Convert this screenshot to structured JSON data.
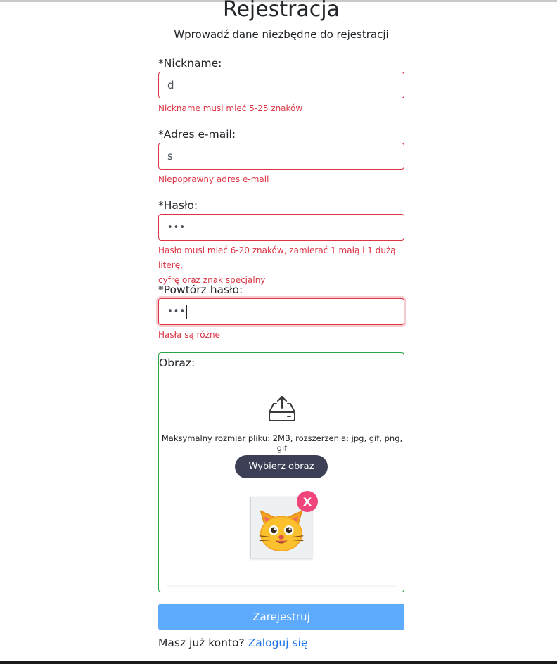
{
  "page": {
    "title": "Rejestracja",
    "subtitle": "Wprowadź dane niezbędne do rejestracji"
  },
  "form": {
    "nickname": {
      "label": "*Nickname:",
      "value": "d",
      "error": "Nickname musi mieć 5-25 znaków"
    },
    "email": {
      "label": "*Adres e-mail:",
      "value": "s",
      "error": "Niepoprawny adres e-mail"
    },
    "password": {
      "label": "*Hasło:",
      "value": "•••",
      "error_line1": "Hasło musi mieć 6-20 znaków, zamierać 1 małą i 1 dużą literę,",
      "error_line2": "cyfrę oraz znak specjalny"
    },
    "password_repeat": {
      "label": "*Powtórz hasło:",
      "value": "•••",
      "error": "Hasła są różne"
    },
    "image": {
      "label": "Obraz:",
      "info": "Maksymalny rozmiar pliku: 2MB, rozszerzenia: jpg, gif, png, gif",
      "button": "Wybierz obraz",
      "remove": "X",
      "icon": "upload-tray-icon",
      "thumbnail": "cat-face"
    },
    "submit": "Zarejestruj",
    "login_prompt": "Masz już konto?",
    "login_link": "Zaloguj się"
  },
  "colors": {
    "error": "#dc3545",
    "valid_border": "#28a745",
    "submit_bg": "#5eaafc",
    "choose_btn_bg": "#3c3f55",
    "remove_badge": "#f0457a",
    "link": "#1a73e8"
  }
}
